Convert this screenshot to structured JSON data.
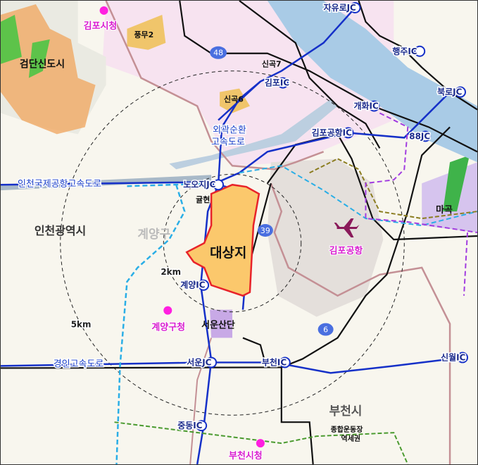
{
  "colors": {
    "site": "#fbc86c",
    "site_border": "#e8232a",
    "expressway": "#1530c8",
    "gimpo_area": "#f7e3f0",
    "river": "#a9cbe6",
    "poi": "#ff1fe0",
    "airport": "#e6e0dc"
  },
  "site": {
    "label": "대상지"
  },
  "radii": {
    "inner": "2km",
    "outer": "5km"
  },
  "districts": [
    {
      "id": "geomdan",
      "label": "검단신도시"
    },
    {
      "id": "incheon",
      "label": "인천광역시"
    },
    {
      "id": "gyeyang-gu",
      "label": "계양구"
    },
    {
      "id": "bucheon",
      "label": "부천시"
    },
    {
      "id": "magok",
      "label": "마곡"
    },
    {
      "id": "pungmu2",
      "label": "풍무2"
    },
    {
      "id": "singok7",
      "label": "신곡7"
    },
    {
      "id": "singok6",
      "label": "신곡6"
    },
    {
      "id": "gyulhyeon",
      "label": "귤현"
    },
    {
      "id": "seoun",
      "label": "서운산단"
    },
    {
      "id": "sports",
      "label": "종합운동장"
    },
    {
      "id": "station",
      "label": "역세권"
    }
  ],
  "pois": [
    {
      "id": "gimpo-cityhall",
      "label": "김포시청"
    },
    {
      "id": "gyeyang-office",
      "label": "계양구청"
    },
    {
      "id": "bucheon-cityhall",
      "label": "부천시청"
    },
    {
      "id": "gimpo-airport",
      "label": "김포공항"
    }
  ],
  "interchanges": [
    {
      "id": "jayuro",
      "label": "자유로JC"
    },
    {
      "id": "haengju",
      "label": "행주IC"
    },
    {
      "id": "gimpo",
      "label": "김포IC"
    },
    {
      "id": "bukro",
      "label": "북로JC"
    },
    {
      "id": "gaehwa",
      "label": "개화IC"
    },
    {
      "id": "gimpo-airport",
      "label": "김포공항IC"
    },
    {
      "id": "88",
      "label": "88JC"
    },
    {
      "id": "noji",
      "label": "노오지JC"
    },
    {
      "id": "gyeyang",
      "label": "계양IC"
    },
    {
      "id": "seoun",
      "label": "서운JC"
    },
    {
      "id": "bucheon",
      "label": "부천IC"
    },
    {
      "id": "sinwol",
      "label": "신월IC"
    },
    {
      "id": "jungdong",
      "label": "중동IC"
    }
  ],
  "highways": [
    {
      "id": "outer-ring",
      "label": "외곽순환",
      "label2": "고속도로"
    },
    {
      "id": "airport-exp",
      "label": "인천국제공항고속도로"
    },
    {
      "id": "gyeongin",
      "label": "경인고속도로"
    }
  ],
  "route_shields": [
    "48",
    "39",
    "6"
  ]
}
